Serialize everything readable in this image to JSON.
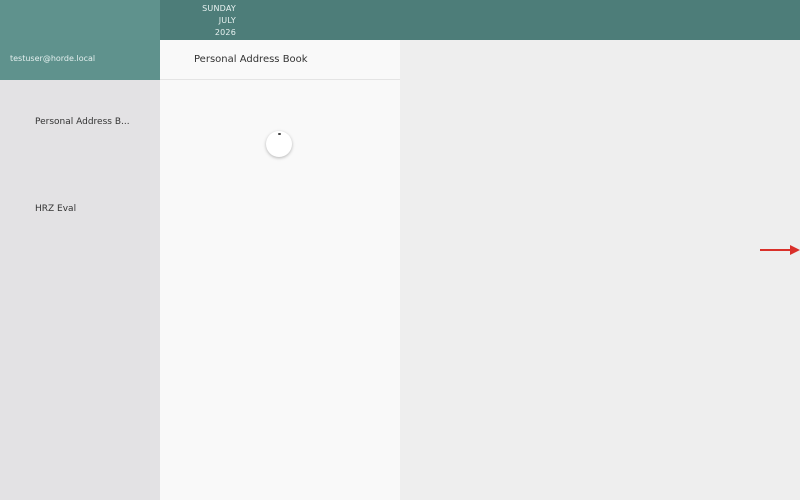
{
  "header": {
    "weekday": "SUNDAY",
    "month": "JULY",
    "year": "2026"
  },
  "user": {
    "email": "testuser@horde.local"
  },
  "sidebar": {
    "items": [
      {
        "label": "Personal Address B..."
      },
      {
        "label": "HRZ Eval"
      }
    ]
  },
  "list": {
    "title": "Personal Address Book"
  },
  "colors": {
    "header_bg": "#4d7d79",
    "user_panel_bg": "#5f928d",
    "sidebar_bg": "#e3e2e4",
    "list_bg": "#f9f9f9",
    "detail_bg": "#eeeeee",
    "arrow": "#d9302a"
  },
  "icons": {
    "loading": "loading-spinner-icon",
    "arrow": "arrow-right-icon"
  }
}
